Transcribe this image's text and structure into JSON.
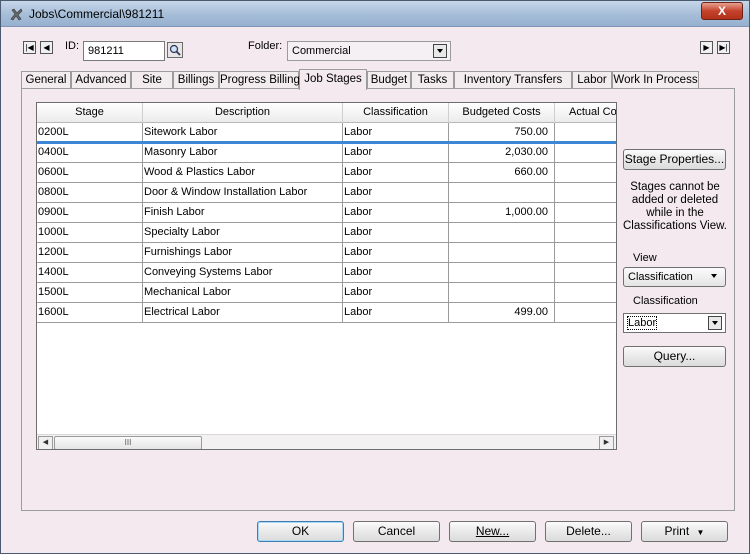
{
  "window": {
    "title": "Jobs\\Commercial\\981211",
    "close_label": "X"
  },
  "header": {
    "id_label": "ID:",
    "id_value": "981211",
    "folder_label": "Folder:",
    "folder_value": "Commercial"
  },
  "tabs": [
    {
      "label": "General"
    },
    {
      "label": "Advanced"
    },
    {
      "label": "Site"
    },
    {
      "label": "Billings"
    },
    {
      "label": "Progress Billing"
    },
    {
      "label": "Job Stages"
    },
    {
      "label": "Budget"
    },
    {
      "label": "Tasks"
    },
    {
      "label": "Inventory Transfers"
    },
    {
      "label": "Labor"
    },
    {
      "label": "Work In Process"
    }
  ],
  "active_tab": "Job Stages",
  "grid": {
    "columns": [
      "Stage",
      "Description",
      "Classification",
      "Budgeted Costs",
      "Actual Co"
    ],
    "rows": [
      {
        "stage": "0200L",
        "description": "Sitework Labor",
        "classification": "Labor",
        "budgeted": "750.00"
      },
      {
        "stage": "0400L",
        "description": "Masonry Labor",
        "classification": "Labor",
        "budgeted": "2,030.00"
      },
      {
        "stage": "0600L",
        "description": "Wood & Plastics Labor",
        "classification": "Labor",
        "budgeted": "660.00"
      },
      {
        "stage": "0800L",
        "description": "Door & Window Installation Labor",
        "classification": "Labor",
        "budgeted": ""
      },
      {
        "stage": "0900L",
        "description": "Finish Labor",
        "classification": "Labor",
        "budgeted": "1,000.00"
      },
      {
        "stage": "1000L",
        "description": "Specialty Labor",
        "classification": "Labor",
        "budgeted": ""
      },
      {
        "stage": "1200L",
        "description": "Furnishings Labor",
        "classification": "Labor",
        "budgeted": ""
      },
      {
        "stage": "1400L",
        "description": "Conveying Systems Labor",
        "classification": "Labor",
        "budgeted": ""
      },
      {
        "stage": "1500L",
        "description": "Mechanical Labor",
        "classification": "Labor",
        "budgeted": ""
      },
      {
        "stage": "1600L",
        "description": "Electrical Labor",
        "classification": "Labor",
        "budgeted": "499.00"
      }
    ],
    "scroll_thumb_label": "III"
  },
  "side": {
    "stage_properties_label": "Stage Properties...",
    "note": "Stages cannot be added or deleted while in the Classifications View.",
    "view_label": "View",
    "view_value": "Classification",
    "classification_label": "Classification",
    "classification_value": "Labor",
    "query_label": "Query..."
  },
  "footer": {
    "ok_label": "OK",
    "cancel_label": "Cancel",
    "new_label": "New...",
    "delete_label": "Delete...",
    "print_label": "Print"
  },
  "colors": {
    "selection_line": "#3b87d6",
    "window_bg": "#f3e9ee"
  }
}
